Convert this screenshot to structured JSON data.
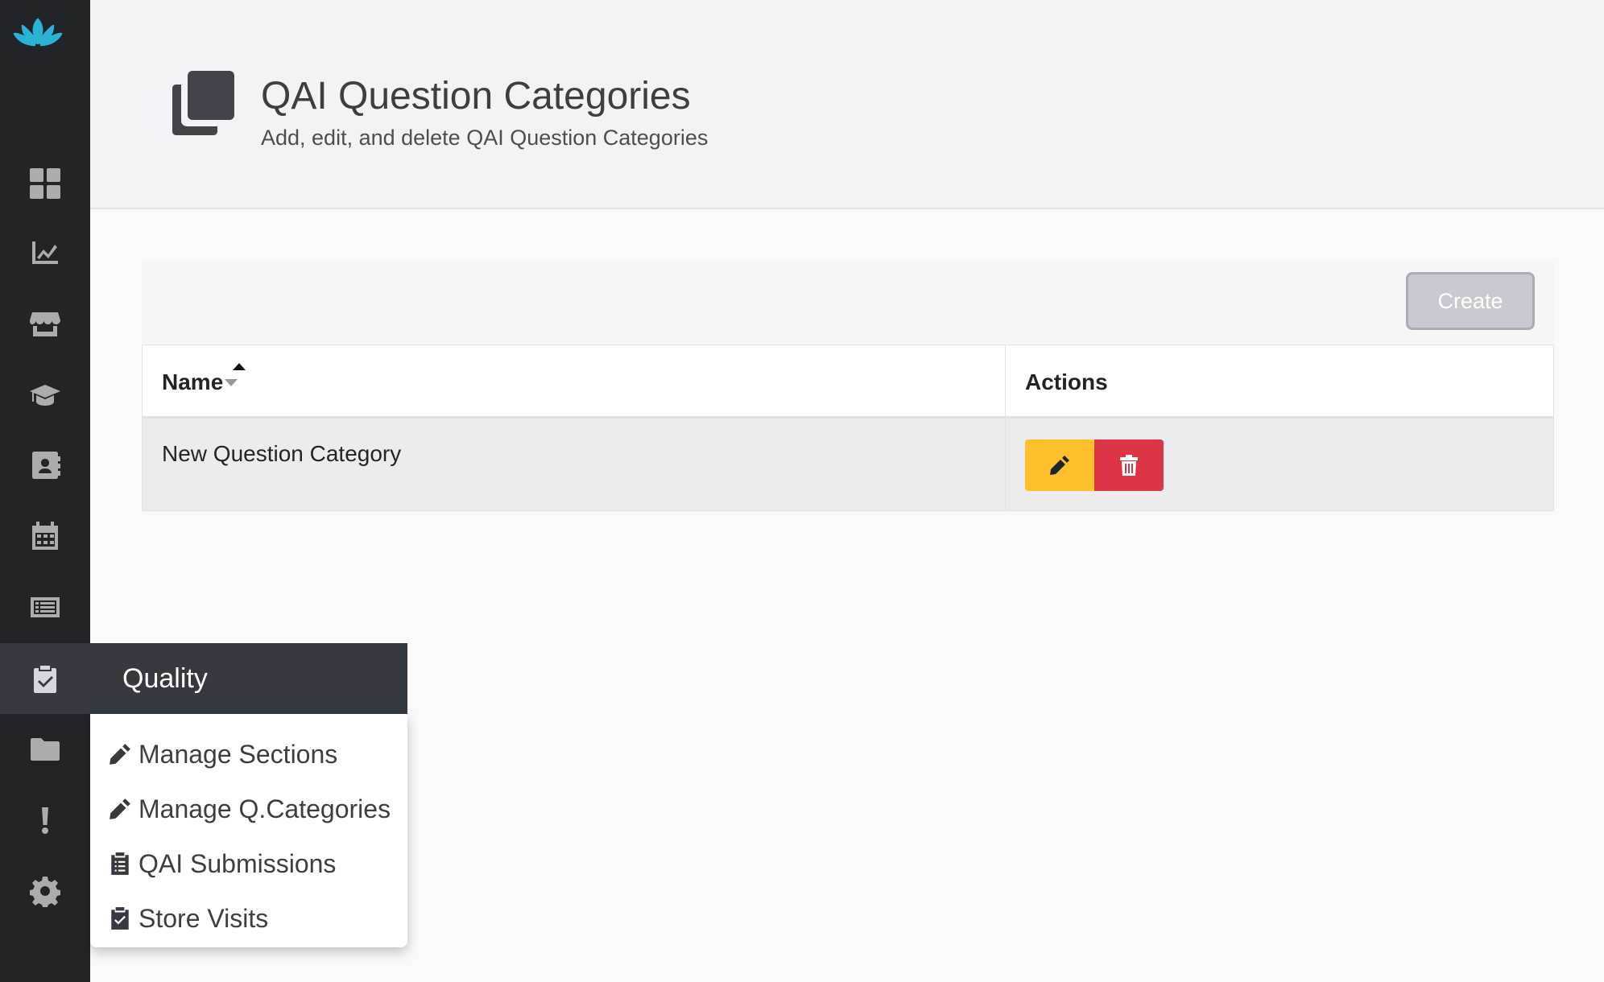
{
  "header": {
    "title": "QAI Question Categories",
    "subtitle": "Add, edit, and delete QAI Question Categories",
    "icon": "clone-icon"
  },
  "sidebar": {
    "logo": "lotus-logo",
    "items": [
      {
        "name": "dashboard",
        "icon": "th-large-icon"
      },
      {
        "name": "analytics",
        "icon": "chart-line-icon"
      },
      {
        "name": "stores",
        "icon": "store-icon"
      },
      {
        "name": "training",
        "icon": "graduation-cap-icon"
      },
      {
        "name": "contacts",
        "icon": "address-book-icon"
      },
      {
        "name": "calendar",
        "icon": "calendar-icon"
      },
      {
        "name": "reports",
        "icon": "list-alt-icon"
      },
      {
        "name": "quality",
        "icon": "clipboard-check-icon",
        "active": true
      },
      {
        "name": "files",
        "icon": "folder-icon"
      },
      {
        "name": "alerts",
        "icon": "exclamation-icon"
      },
      {
        "name": "settings",
        "icon": "cog-icon"
      }
    ]
  },
  "toolbar": {
    "create_label": "Create"
  },
  "table": {
    "columns": [
      "Name",
      "Actions"
    ],
    "rows": [
      {
        "name": "New Question Category"
      }
    ]
  },
  "flyout": {
    "title": "Quality",
    "items": [
      {
        "label": "Manage Sections",
        "icon": "pencil-icon"
      },
      {
        "label": "Manage Q.Categories",
        "icon": "pencil-icon"
      },
      {
        "label": "QAI Submissions",
        "icon": "clipboard-list-icon"
      },
      {
        "label": "Store Visits",
        "icon": "clipboard-check-icon"
      }
    ]
  },
  "colors": {
    "sidebar_bg": "#212529",
    "header_bg": "#f1f4f7",
    "edit_button": "#ffc02e",
    "delete_button": "#dc3545",
    "create_button": "#c6cbd1"
  }
}
